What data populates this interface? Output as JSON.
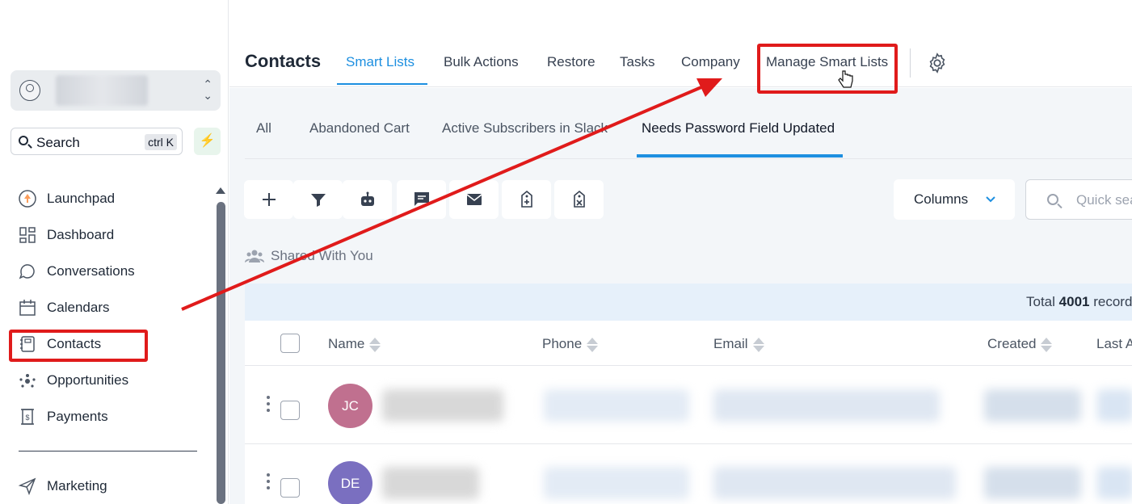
{
  "sidebar": {
    "search_label": "Search",
    "search_shortcut": "ctrl K",
    "items": [
      {
        "label": "Launchpad",
        "icon": "launchpad-icon"
      },
      {
        "label": "Dashboard",
        "icon": "dashboard-icon"
      },
      {
        "label": "Conversations",
        "icon": "conversations-icon"
      },
      {
        "label": "Calendars",
        "icon": "calendar-icon"
      },
      {
        "label": "Contacts",
        "icon": "contacts-icon"
      },
      {
        "label": "Opportunities",
        "icon": "opportunities-icon"
      },
      {
        "label": "Payments",
        "icon": "payments-icon"
      },
      {
        "label": "Marketing",
        "icon": "marketing-icon"
      }
    ]
  },
  "header": {
    "title": "Contacts",
    "tabs": [
      {
        "label": "Smart Lists",
        "active": true
      },
      {
        "label": "Bulk Actions"
      },
      {
        "label": "Restore"
      },
      {
        "label": "Tasks"
      },
      {
        "label": "Company"
      },
      {
        "label": "Manage Smart Lists"
      }
    ]
  },
  "smart_lists": {
    "tabs": [
      {
        "label": "All"
      },
      {
        "label": "Abandoned Cart"
      },
      {
        "label": "Active Subscribers in Slack"
      },
      {
        "label": "Needs Password Field Updated",
        "active": true
      }
    ]
  },
  "toolbar": {
    "columns_label": "Columns",
    "quick_search_placeholder": "Quick search"
  },
  "shared_label": "Shared With You",
  "total": {
    "prefix": "Total",
    "count": "4001",
    "suffix": "records"
  },
  "table": {
    "columns": [
      "Name",
      "Phone",
      "Email",
      "Created",
      "Last A"
    ],
    "rows": [
      {
        "initials": "JC",
        "avatar_color": "#c0708f"
      },
      {
        "initials": "DE",
        "avatar_color": "#7a6fc0"
      }
    ]
  },
  "colors": {
    "accent": "#1d8fe0",
    "annotation": "#e01b1b"
  }
}
